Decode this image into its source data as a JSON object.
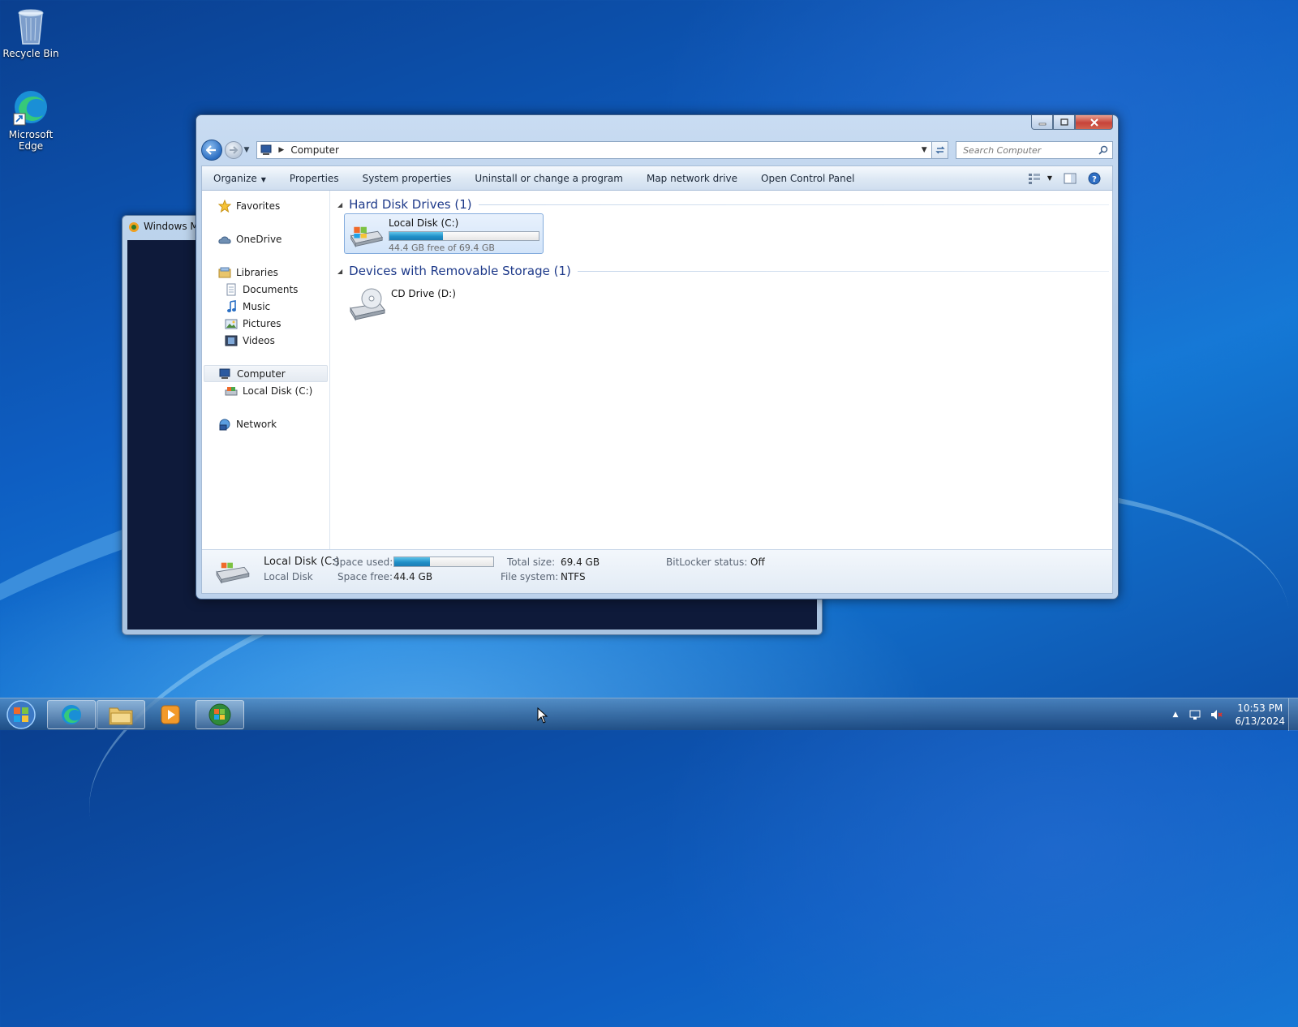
{
  "desktop": {
    "icons": [
      {
        "label": "Recycle Bin",
        "icon": "recycle-bin-icon"
      },
      {
        "label": "Microsoft Edge",
        "icon": "edge-icon"
      }
    ]
  },
  "background_window": {
    "title": "Windows M"
  },
  "explorer": {
    "address": {
      "crumb": "Computer",
      "search_placeholder": "Search Computer"
    },
    "toolbar": {
      "organize": "Organize",
      "properties": "Properties",
      "system_properties": "System properties",
      "uninstall": "Uninstall or change a program",
      "map_drive": "Map network drive",
      "control_panel": "Open Control Panel"
    },
    "nav": {
      "favorites": "Favorites",
      "onedrive": "OneDrive",
      "libraries": "Libraries",
      "documents": "Documents",
      "music": "Music",
      "pictures": "Pictures",
      "videos": "Videos",
      "computer": "Computer",
      "local_disk": "Local Disk (C:)",
      "network": "Network"
    },
    "groups": {
      "hard_disks": "Hard Disk Drives (1)",
      "removable": "Devices with Removable Storage (1)"
    },
    "drives": {
      "c": {
        "name": "Local Disk (C:)",
        "free_text": "44.4 GB free of 69.4 GB",
        "used_fraction": 0.36
      },
      "d": {
        "name": "CD Drive (D:)"
      }
    },
    "details": {
      "name": "Local Disk (C:)",
      "type": "Local Disk",
      "space_used_label": "Space used:",
      "space_free_label": "Space free:",
      "space_free": "44.4 GB",
      "total_size_label": "Total size:",
      "total_size": "69.4 GB",
      "file_system_label": "File system:",
      "file_system": "NTFS",
      "bitlocker_label": "BitLocker status:",
      "bitlocker": "Off",
      "used_fraction": 0.36
    }
  },
  "taskbar": {
    "time": "10:53 PM",
    "date": "6/13/2024"
  },
  "colors": {
    "accent": "#1f8fc8",
    "link_blue": "#1e3a8a"
  }
}
